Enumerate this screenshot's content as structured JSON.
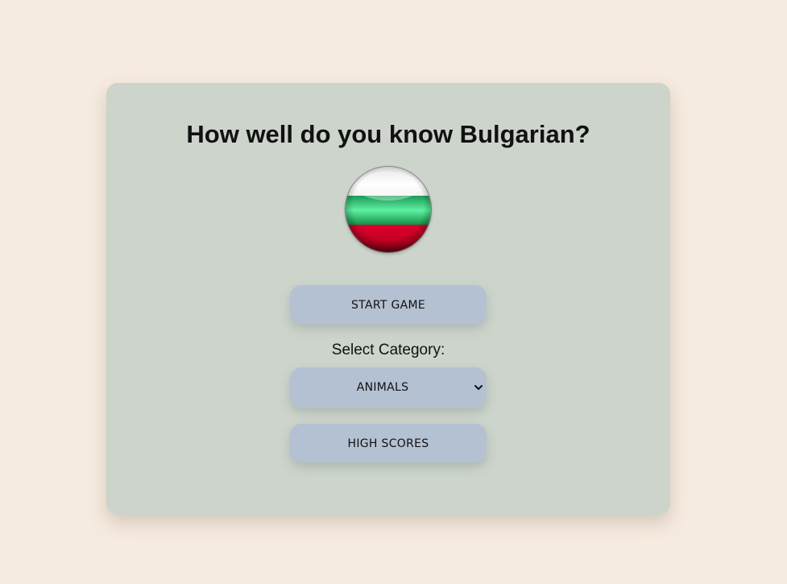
{
  "page": {
    "title": "How well do you know Bulgarian?"
  },
  "flag": {
    "icon": "bulgaria-flag-icon",
    "colors": [
      "#ffffff",
      "#1fa45f",
      "#d2002b"
    ]
  },
  "buttons": {
    "start_label": "START GAME",
    "high_scores_label": "HIGH SCORES"
  },
  "category": {
    "label": "Select Category:",
    "selected": "ANIMALS"
  },
  "colors": {
    "background": "#f6ebe0",
    "card": "#ccd4cb",
    "button": "#b4c1d2"
  }
}
